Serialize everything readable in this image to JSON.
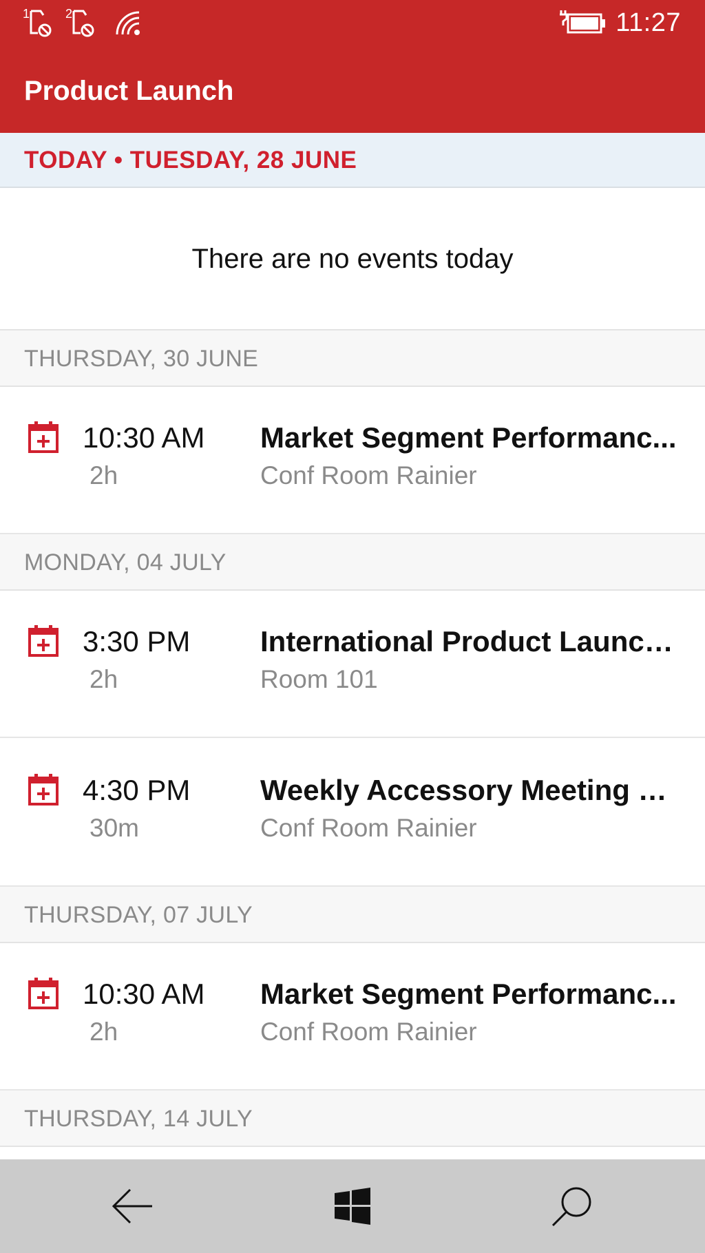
{
  "status_bar": {
    "sim1_label": "1",
    "sim2_label": "2",
    "time": "11:27"
  },
  "header": {
    "title": "Product Launch"
  },
  "today": {
    "label": "TODAY • TUESDAY, 28 JUNE",
    "empty_message": "There are no events today"
  },
  "days": [
    {
      "label": "THURSDAY, 30 JUNE",
      "events": [
        {
          "time": "10:30 AM",
          "duration": "2h",
          "title": "Market Segment Performanc...",
          "location": "Conf Room Rainier"
        }
      ]
    },
    {
      "label": "MONDAY, 04 JULY",
      "events": [
        {
          "time": "3:30 PM",
          "duration": "2h",
          "title": "International Product Launch...",
          "location": "Room 101"
        },
        {
          "time": "4:30 PM",
          "duration": "30m",
          "title": "Weekly Accessory Meeting wi...",
          "location": "Conf Room Rainier"
        }
      ]
    },
    {
      "label": "THURSDAY, 07 JULY",
      "events": [
        {
          "time": "10:30 AM",
          "duration": "2h",
          "title": "Market Segment Performanc...",
          "location": "Conf Room Rainier"
        }
      ]
    },
    {
      "label": "THURSDAY, 14 JULY",
      "events": []
    }
  ],
  "icons": {
    "calendar_event": "calendar-add-icon",
    "back": "back-arrow-icon",
    "start": "windows-icon",
    "search": "search-icon"
  },
  "colors": {
    "accent": "#c62828",
    "today_text": "#d0202e",
    "today_bg": "#e9f1f8",
    "nav_bg": "#cbcbcb"
  }
}
